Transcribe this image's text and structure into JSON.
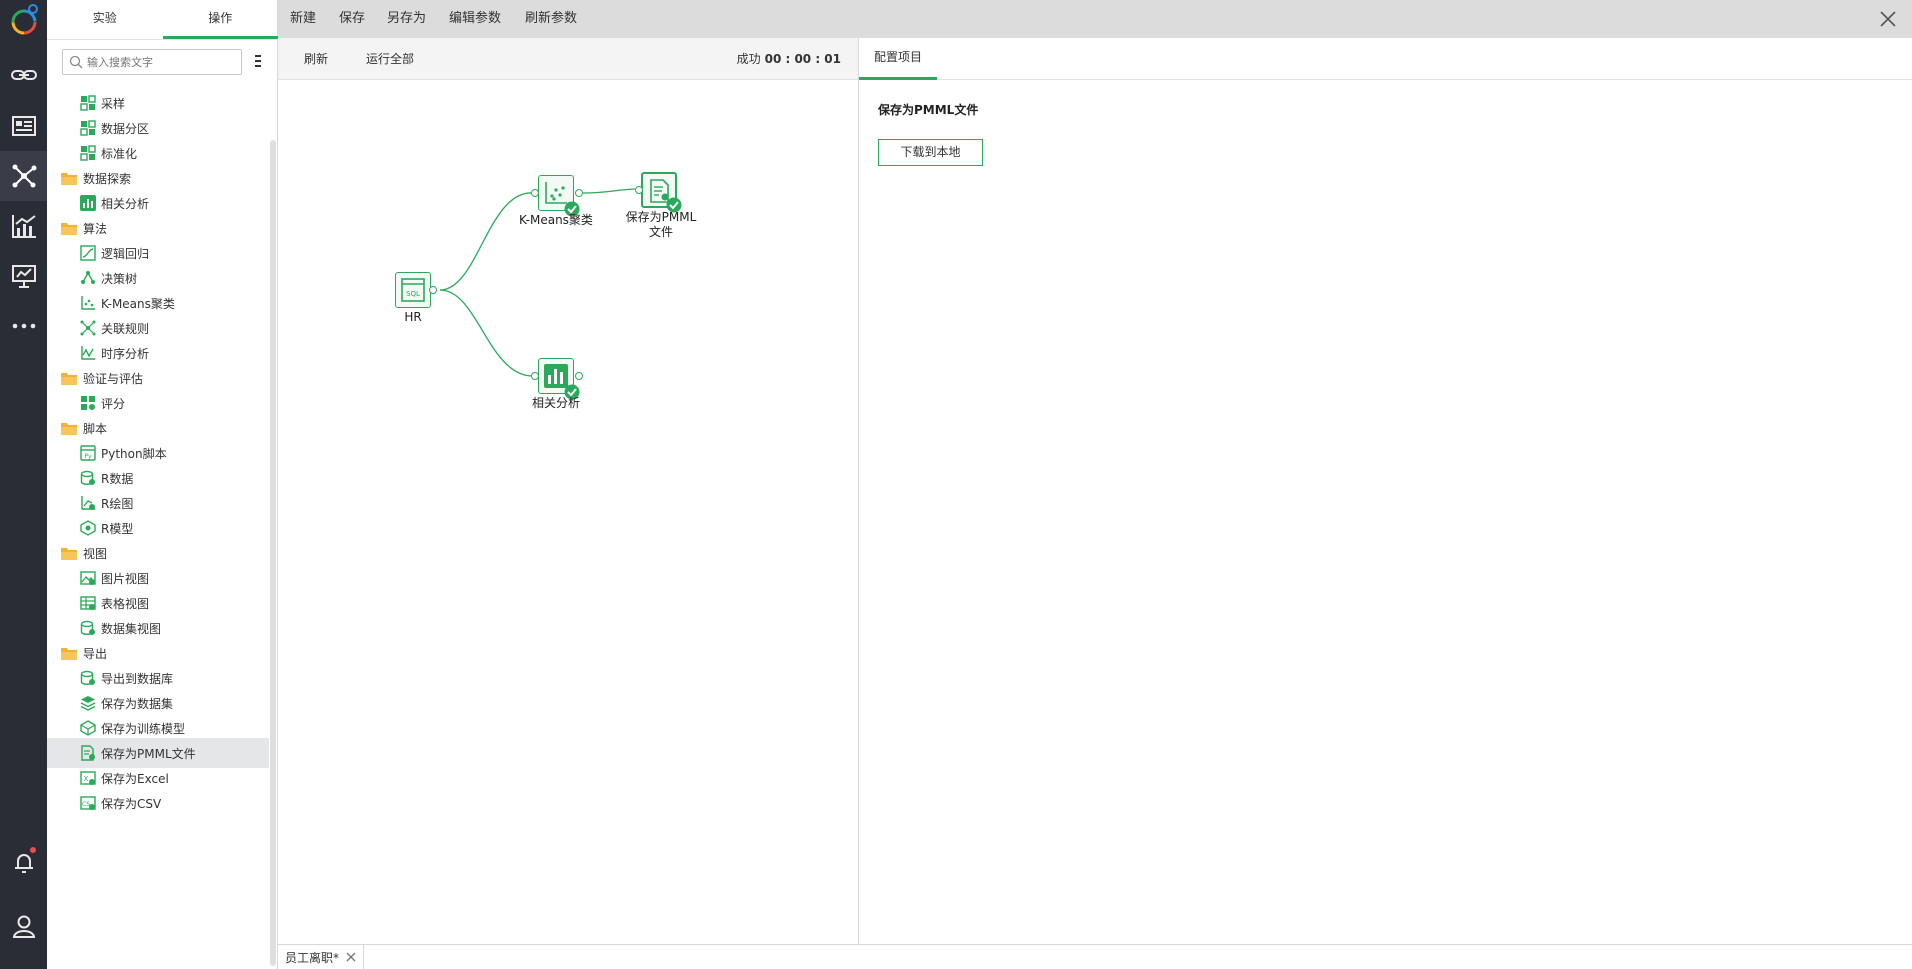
{
  "sidebar_tabs": {
    "experiment": "实验",
    "operation": "操作"
  },
  "search": {
    "placeholder": "输入搜索文字"
  },
  "tree": {
    "leaf_sampling": "采样",
    "leaf_partition": "数据分区",
    "leaf_normalize": "标准化",
    "cat_explore": "数据探索",
    "leaf_correlation": "相关分析",
    "cat_algorithm": "算法",
    "leaf_logistic": "逻辑回归",
    "leaf_dtree": "决策树",
    "leaf_kmeans": "K-Means聚类",
    "leaf_assoc": "关联规则",
    "leaf_timeseries": "时序分析",
    "cat_validate": "验证与评估",
    "leaf_score": "评分",
    "cat_script": "脚本",
    "leaf_python": "Python脚本",
    "leaf_rdata": "R数据",
    "leaf_rplot": "R绘图",
    "leaf_rmodel": "R模型",
    "cat_view": "视图",
    "leaf_imgview": "图片视图",
    "leaf_tableview": "表格视图",
    "leaf_datasetview": "数据集视图",
    "cat_export": "导出",
    "leaf_todb": "导出到数据库",
    "leaf_todataset": "保存为数据集",
    "leaf_tomodel": "保存为训练模型",
    "leaf_topmml": "保存为PMML文件",
    "leaf_toexcel": "保存为Excel",
    "leaf_tocsv": "保存为CSV"
  },
  "menu": {
    "new": "新建",
    "save": "保存",
    "save_as": "另存为",
    "edit_params": "编辑参数",
    "refresh_params": "刷新参数"
  },
  "toolbar": {
    "refresh": "刷新",
    "run_all": "运行全部",
    "status": "成功",
    "elapsed": "00 : 00 : 01"
  },
  "canvas": {
    "node_hr": "HR",
    "node_kmeans": "K-Means聚类",
    "node_pmml_line1": "保存为PMML",
    "node_pmml_line2": "文件",
    "node_corr": "相关分析"
  },
  "config": {
    "tab": "配置项目",
    "title": "保存为PMML文件",
    "download": "下载到本地"
  },
  "bottom": {
    "doc_tab": "员工离职*"
  },
  "colors": {
    "accent": "#2ba95a",
    "rail": "#2b2d36",
    "topbar": "#dcdcdc"
  }
}
